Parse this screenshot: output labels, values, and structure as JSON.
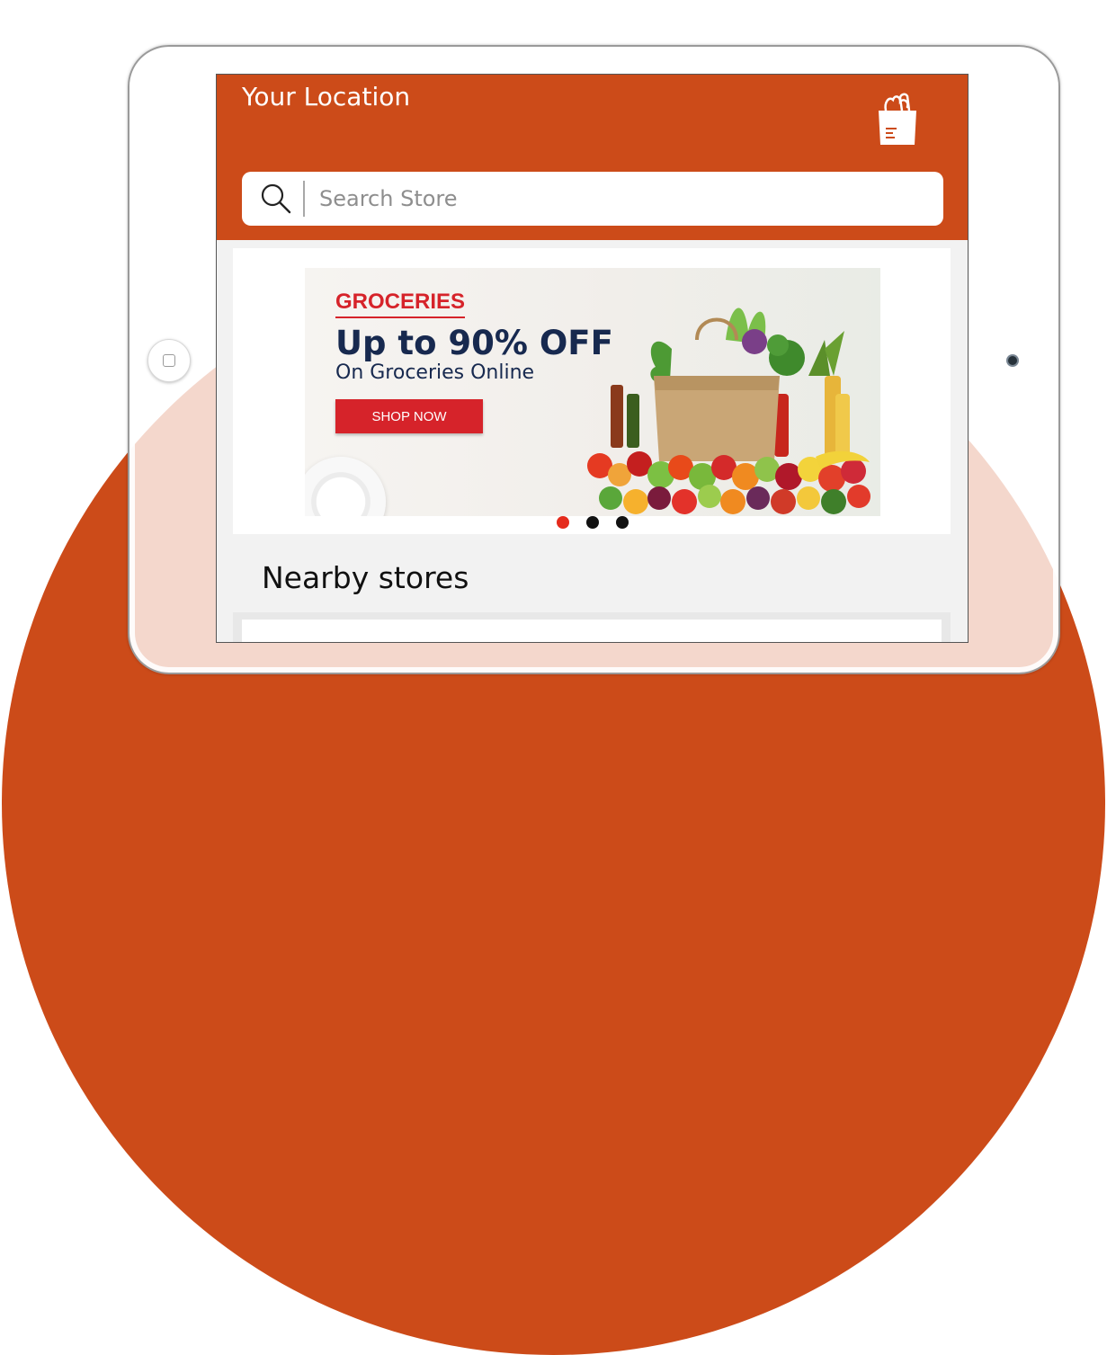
{
  "header": {
    "title": "Your Location",
    "cart_icon": "grocery-bag-icon"
  },
  "search": {
    "placeholder": "Search Store",
    "icon": "search-icon"
  },
  "banner": {
    "category": "GROCERIES",
    "headline": "Up to 90% OFF",
    "subheadline": "On Groceries Online",
    "cta_label": "SHOP NOW",
    "slides_total": 3,
    "active_slide": 1
  },
  "nearby": {
    "title": "Nearby stores"
  },
  "colors": {
    "brand_orange": "#cc4b19",
    "promo_red": "#d6232a",
    "promo_navy": "#17294f",
    "dot_active": "#e52b1c"
  }
}
